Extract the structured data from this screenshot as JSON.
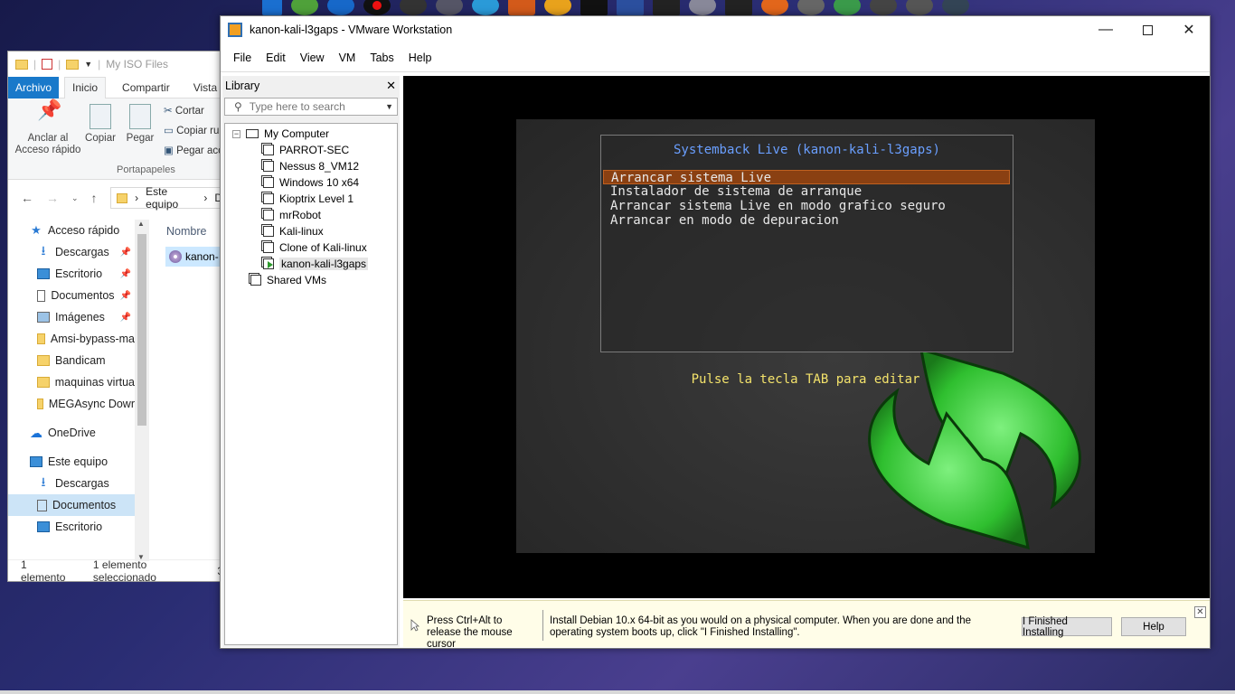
{
  "explorer": {
    "title": "My ISO Files",
    "tabs": [
      "Archivo",
      "Inicio",
      "Compartir",
      "Vista"
    ],
    "ribbon": {
      "pin_label": "Anclar al Acceso rápido",
      "copy_label": "Copiar",
      "paste_label": "Pegar",
      "cut_label": "Cortar",
      "copy_path_label": "Copiar ru",
      "paste_shortcut_label": "Pegar acc",
      "group_label": "Portapapeles"
    },
    "address": [
      "Este equipo",
      "D"
    ],
    "column_header": "Nombre",
    "file_name": "kanon-",
    "nav": [
      {
        "label": "Acceso rápido",
        "pinned": false,
        "icon": "star-icon"
      },
      {
        "label": "Descargas",
        "pinned": true,
        "icon": "download-icon"
      },
      {
        "label": "Escritorio",
        "pinned": true,
        "icon": "desktop-icon"
      },
      {
        "label": "Documentos",
        "pinned": true,
        "icon": "document-icon"
      },
      {
        "label": "Imágenes",
        "pinned": true,
        "icon": "image-icon"
      },
      {
        "label": "Amsi-bypass-ma",
        "pinned": false,
        "icon": "folder-icon"
      },
      {
        "label": "Bandicam",
        "pinned": false,
        "icon": "folder-icon"
      },
      {
        "label": "maquinas virtua",
        "pinned": false,
        "icon": "folder-icon"
      },
      {
        "label": "MEGAsync Dowr",
        "pinned": false,
        "icon": "folder-icon"
      },
      {
        "label": "OneDrive",
        "pinned": false,
        "icon": "cloud-icon"
      },
      {
        "label": "Este equipo",
        "pinned": false,
        "icon": "computer-icon"
      },
      {
        "label": "Descargas",
        "pinned": false,
        "icon": "download-icon"
      },
      {
        "label": "Documentos",
        "pinned": false,
        "icon": "document-icon"
      },
      {
        "label": "Escritorio",
        "pinned": false,
        "icon": "desktop-icon"
      }
    ],
    "status": {
      "count": "1 elemento",
      "selected": "1 elemento seleccionado",
      "extra": "3"
    }
  },
  "vmware": {
    "title": "kanon-kali-l3gaps - VMware Workstation",
    "menu": [
      "File",
      "Edit",
      "View",
      "VM",
      "Tabs",
      "Help"
    ],
    "library": {
      "title": "Library",
      "search_placeholder": "Type here to search",
      "root": "My Computer",
      "vms": [
        "PARROT-SEC",
        "Nessus 8_VM12",
        "Windows 10 x64",
        "Kioptrix Level 1",
        "mrRobot",
        "Kali-linux",
        "Clone of Kali-linux",
        "kanon-kali-l3gaps"
      ],
      "selected_vm": "kanon-kali-l3gaps",
      "shared": "Shared VMs"
    },
    "boot": {
      "title": "Systemback Live (kanon-kali-l3gaps)",
      "options": [
        "Arrancar sistema Live",
        "Instalador de sistema de arranque",
        "Arrancar sistema Live en modo grafico seguro",
        "Arrancar en modo de depuracion"
      ],
      "hint": "Pulse la tecla TAB para editar"
    },
    "hintbar": {
      "release": "Press Ctrl+Alt to release the mouse cursor",
      "install": "Install Debian 10.x 64-bit as you would on a physical computer. When you are done and the operating system boots up, click \"I Finished Installing\".",
      "finished_button": "I Finished Installing",
      "help_button": "Help"
    }
  },
  "colors": {
    "accent": "#1979ca",
    "boot_title": "#6a9fff",
    "boot_hint": "#f4e36b",
    "boot_selected": "#8a4012",
    "arrows": "#3cc43c"
  }
}
